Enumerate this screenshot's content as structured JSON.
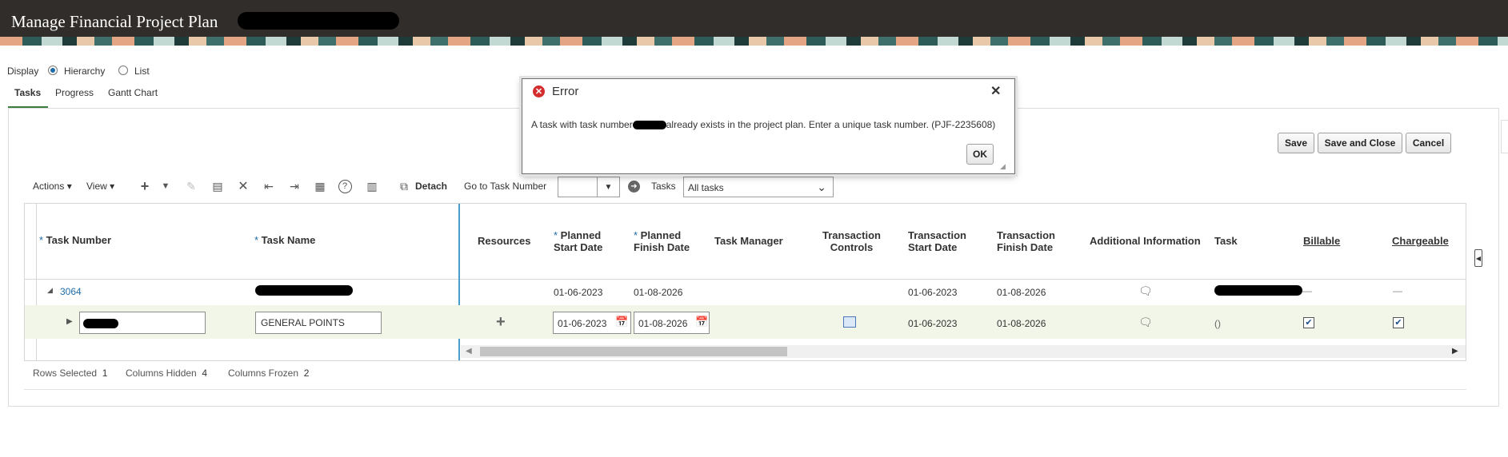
{
  "header": {
    "title": "Manage Financial Project Plan"
  },
  "display": {
    "label": "Display",
    "options": [
      {
        "label": "Hierarchy",
        "selected": true
      },
      {
        "label": "List",
        "selected": false
      }
    ]
  },
  "tabs": [
    {
      "label": "Tasks",
      "active": true
    },
    {
      "label": "Progress",
      "active": false
    },
    {
      "label": "Gantt Chart",
      "active": false
    }
  ],
  "actions": {
    "save": "Save",
    "save_close": "Save and Close",
    "cancel": "Cancel"
  },
  "toolbar": {
    "actions_label": "Actions",
    "view_label": "View",
    "detach_label": "Detach",
    "goto_label": "Go to Task Number",
    "goto_value": "",
    "tasks_label": "Tasks",
    "tasks_filter": "All tasks"
  },
  "table": {
    "columns": {
      "task_number": "Task Number",
      "task_name": "Task Name",
      "resources": "Resources",
      "planned_start_1": "Planned",
      "planned_start_2": "Start Date",
      "planned_finish_1": "Planned",
      "planned_finish_2": "Finish Date",
      "task_manager": "Task Manager",
      "txn_controls_1": "Transaction",
      "txn_controls_2": "Controls",
      "txn_start_1": "Transaction",
      "txn_start_2": "Start Date",
      "txn_finish_1": "Transaction",
      "txn_finish_2": "Finish Date",
      "additional_info": "Additional Information",
      "task": "Task",
      "billable": "Billable",
      "chargeable": "Chargeable"
    },
    "rows": [
      {
        "task_number": "3064",
        "planned_start": "01-06-2023",
        "planned_finish": "01-08-2026",
        "txn_start": "01-06-2023",
        "txn_finish": "01-08-2026",
        "billable": "—",
        "chargeable": "—"
      },
      {
        "task_name": "GENERAL POINTS",
        "planned_start": "01-06-2023",
        "planned_finish": "01-08-2026",
        "txn_start": "01-06-2023",
        "txn_finish": "01-08-2026",
        "task": "()",
        "billable_checked": true,
        "chargeable_checked": true
      }
    ]
  },
  "status": {
    "rows_selected_label": "Rows Selected",
    "rows_selected": "1",
    "columns_hidden_label": "Columns Hidden",
    "columns_hidden": "4",
    "columns_frozen_label": "Columns Frozen",
    "columns_frozen": "2"
  },
  "dialog": {
    "title": "Error",
    "message_before": "A task with task number",
    "message_after": "already exists in the project plan. Enter a unique task number. (PJF-2235608)",
    "ok": "OK"
  },
  "colors": {
    "header_bg": "#312d2a",
    "link": "#1f6ca8",
    "error": "#d42d2d",
    "selected_row": "#f2f6e8"
  }
}
